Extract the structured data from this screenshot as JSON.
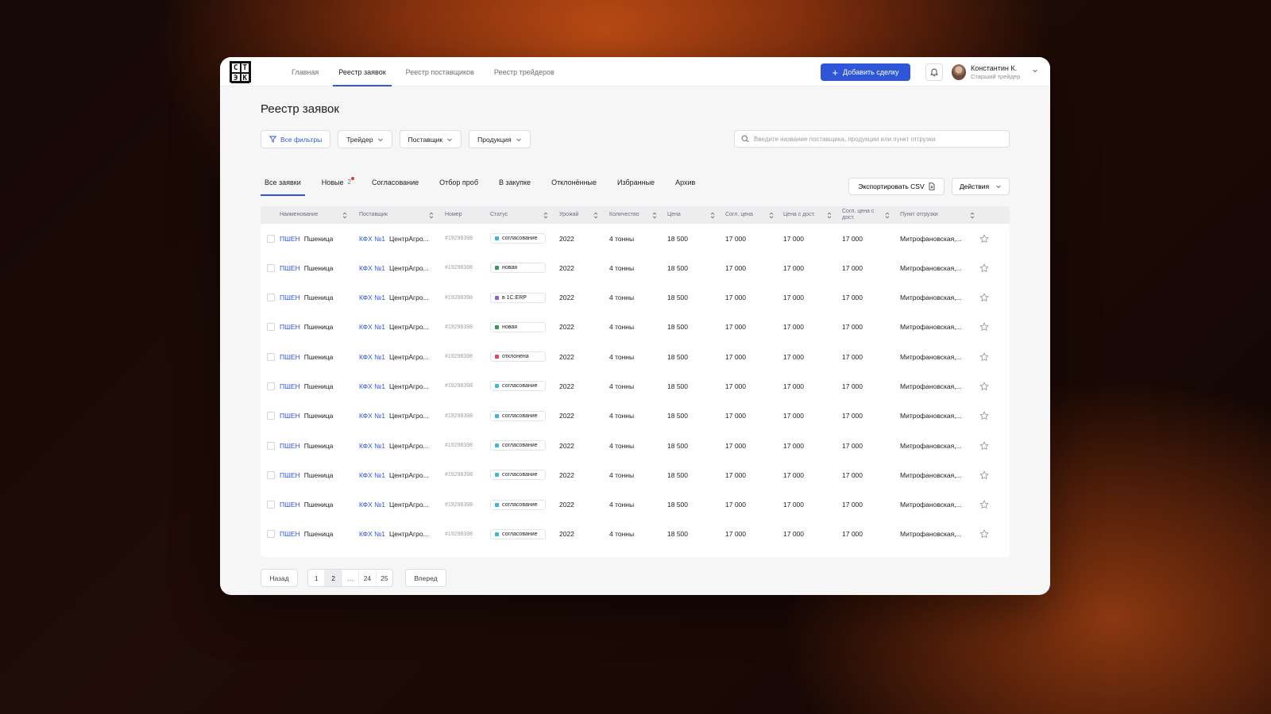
{
  "logo": {
    "letters": [
      "С",
      "Т",
      "Э",
      "К"
    ]
  },
  "nav": {
    "items": [
      {
        "label": "Главная",
        "active": false
      },
      {
        "label": "Реестр заявок",
        "active": true
      },
      {
        "label": "Реестр поставщиков",
        "active": false
      },
      {
        "label": "Реестр трейдеров",
        "active": false
      }
    ]
  },
  "header": {
    "add_deal_label": "Добавить сделку",
    "user_name": "Константин К.",
    "user_role": "Старший трейдер"
  },
  "page": {
    "title": "Реестр заявок"
  },
  "filters": {
    "all_filters_label": "Все фильтры",
    "dropdowns": [
      "Трейдер",
      "Поставщик",
      "Продукция"
    ],
    "search_placeholder": "Введите название поставщика, продукции или пункт отгрузки"
  },
  "tabs": [
    {
      "label": "Все заявки",
      "active": true
    },
    {
      "label": "Новые",
      "count": "2",
      "active": false,
      "has_dot": true
    },
    {
      "label": "Согласование",
      "active": false
    },
    {
      "label": "Отбор проб",
      "active": false
    },
    {
      "label": "В закупке",
      "active": false
    },
    {
      "label": "Отклонённые",
      "active": false
    },
    {
      "label": "Избранные",
      "active": false
    },
    {
      "label": "Архив",
      "active": false
    }
  ],
  "toolbar": {
    "export_label": "Экспортировать CSV",
    "actions_label": "Действия"
  },
  "table": {
    "columns": [
      "Наименование",
      "Поставщик",
      "Номер",
      "Статус",
      "Урожай",
      "Количество",
      "Цена",
      "Согл. цена",
      "Цена с дост.",
      "Согл. цена с дост.",
      "Пункт отгрузки"
    ],
    "status_colors": {
      "согласование": "#3fb7d3",
      "новая": "#2e9e5b",
      "в 1С:ERP": "#9b59c9",
      "отклонена": "#e0455a"
    },
    "rows": [
      {
        "code": "ПШЕН",
        "name": "Пшеница",
        "supplier_code": "КФХ №1",
        "supplier": "ЦентрАгро...",
        "number": "#19298398",
        "status": "согласование",
        "harvest": "2022",
        "quantity": "4 тонны",
        "price": "18 500",
        "agreed_price": "17 000",
        "price_delivery": "17 000",
        "agreed_price_delivery": "17 000",
        "shipping_point": "Митрофановская,..."
      },
      {
        "code": "ПШЕН",
        "name": "Пшеница",
        "supplier_code": "КФХ №1",
        "supplier": "ЦентрАгро...",
        "number": "#19298398",
        "status": "новая",
        "harvest": "2022",
        "quantity": "4 тонны",
        "price": "18 500",
        "agreed_price": "17 000",
        "price_delivery": "17 000",
        "agreed_price_delivery": "17 000",
        "shipping_point": "Митрофановская,..."
      },
      {
        "code": "ПШЕН",
        "name": "Пшеница",
        "supplier_code": "КФХ №1",
        "supplier": "ЦентрАгро...",
        "number": "#19298398",
        "status": "в 1С:ERP",
        "harvest": "2022",
        "quantity": "4 тонны",
        "price": "18 500",
        "agreed_price": "17 000",
        "price_delivery": "17 000",
        "agreed_price_delivery": "17 000",
        "shipping_point": "Митрофановская,..."
      },
      {
        "code": "ПШЕН",
        "name": "Пшеница",
        "supplier_code": "КФХ №1",
        "supplier": "ЦентрАгро...",
        "number": "#19298398",
        "status": "новая",
        "harvest": "2022",
        "quantity": "4 тонны",
        "price": "18 500",
        "agreed_price": "17 000",
        "price_delivery": "17 000",
        "agreed_price_delivery": "17 000",
        "shipping_point": "Митрофановская,..."
      },
      {
        "code": "ПШЕН",
        "name": "Пшеница",
        "supplier_code": "КФХ №1",
        "supplier": "ЦентрАгро...",
        "number": "#19298398",
        "status": "отклонена",
        "harvest": "2022",
        "quantity": "4 тонны",
        "price": "18 500",
        "agreed_price": "17 000",
        "price_delivery": "17 000",
        "agreed_price_delivery": "17 000",
        "shipping_point": "Митрофановская,..."
      },
      {
        "code": "ПШЕН",
        "name": "Пшеница",
        "supplier_code": "КФХ №1",
        "supplier": "ЦентрАгро...",
        "number": "#19298398",
        "status": "согласование",
        "harvest": "2022",
        "quantity": "4 тонны",
        "price": "18 500",
        "agreed_price": "17 000",
        "price_delivery": "17 000",
        "agreed_price_delivery": "17 000",
        "shipping_point": "Митрофановская,..."
      },
      {
        "code": "ПШЕН",
        "name": "Пшеница",
        "supplier_code": "КФХ №1",
        "supplier": "ЦентрАгро...",
        "number": "#19298398",
        "status": "согласование",
        "harvest": "2022",
        "quantity": "4 тонны",
        "price": "18 500",
        "agreed_price": "17 000",
        "price_delivery": "17 000",
        "agreed_price_delivery": "17 000",
        "shipping_point": "Митрофановская,..."
      },
      {
        "code": "ПШЕН",
        "name": "Пшеница",
        "supplier_code": "КФХ №1",
        "supplier": "ЦентрАгро...",
        "number": "#19298398",
        "status": "согласование",
        "harvest": "2022",
        "quantity": "4 тонны",
        "price": "18 500",
        "agreed_price": "17 000",
        "price_delivery": "17 000",
        "agreed_price_delivery": "17 000",
        "shipping_point": "Митрофановская,..."
      },
      {
        "code": "ПШЕН",
        "name": "Пшеница",
        "supplier_code": "КФХ №1",
        "supplier": "ЦентрАгро...",
        "number": "#19298398",
        "status": "согласование",
        "harvest": "2022",
        "quantity": "4 тонны",
        "price": "18 500",
        "agreed_price": "17 000",
        "price_delivery": "17 000",
        "agreed_price_delivery": "17 000",
        "shipping_point": "Митрофановская,..."
      },
      {
        "code": "ПШЕН",
        "name": "Пшеница",
        "supplier_code": "КФХ №1",
        "supplier": "ЦентрАгро...",
        "number": "#19298398",
        "status": "согласование",
        "harvest": "2022",
        "quantity": "4 тонны",
        "price": "18 500",
        "agreed_price": "17 000",
        "price_delivery": "17 000",
        "agreed_price_delivery": "17 000",
        "shipping_point": "Митрофановская,..."
      },
      {
        "code": "ПШЕН",
        "name": "Пшеница",
        "supplier_code": "КФХ №1",
        "supplier": "ЦентрАгро...",
        "number": "#19298398",
        "status": "согласование",
        "harvest": "2022",
        "quantity": "4 тонны",
        "price": "18 500",
        "agreed_price": "17 000",
        "price_delivery": "17 000",
        "agreed_price_delivery": "17 000",
        "shipping_point": "Митрофановская,..."
      }
    ]
  },
  "pagination": {
    "prev_label": "Назад",
    "next_label": "Вперед",
    "pages": [
      "1",
      "2",
      "...",
      "24",
      "25"
    ],
    "current": "2"
  }
}
